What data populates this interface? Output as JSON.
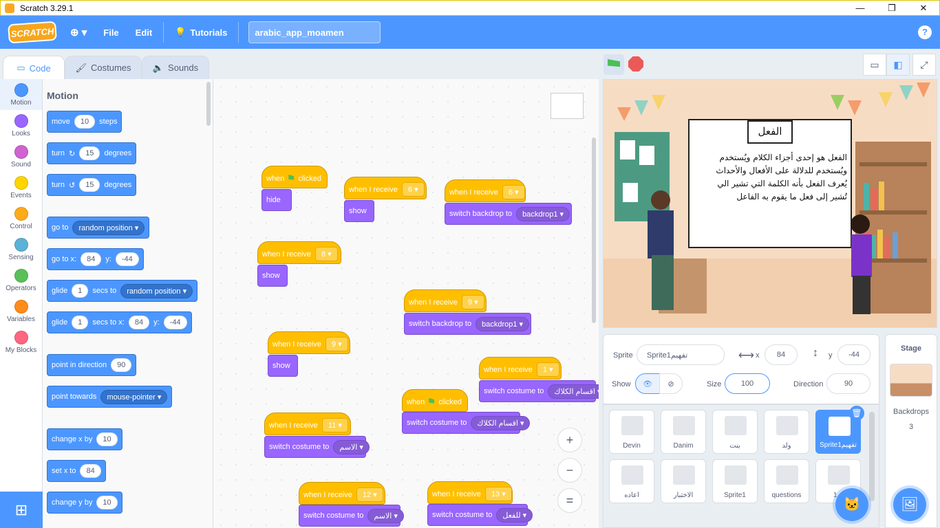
{
  "window": {
    "title": "Scratch 3.29.1",
    "min": "—",
    "max": "❐",
    "close": "✕"
  },
  "menubar": {
    "logo": "SCRATCH",
    "globe": "⊕ ▾",
    "file": "File",
    "edit": "Edit",
    "tutorials": "Tutorials",
    "project_title": "arabic_app_moamen",
    "help": "?"
  },
  "tabs": {
    "code": "Code",
    "costumes": "Costumes",
    "sounds": "Sounds"
  },
  "categories": [
    {
      "label": "Motion",
      "color": "#4c97ff"
    },
    {
      "label": "Looks",
      "color": "#9966ff"
    },
    {
      "label": "Sound",
      "color": "#cf63cf"
    },
    {
      "label": "Events",
      "color": "#ffd500"
    },
    {
      "label": "Control",
      "color": "#ffab19"
    },
    {
      "label": "Sensing",
      "color": "#5cb1d6"
    },
    {
      "label": "Operators",
      "color": "#59c059"
    },
    {
      "label": "Variables",
      "color": "#ff8c1a"
    },
    {
      "label": "My Blocks",
      "color": "#ff6680"
    }
  ],
  "palette": {
    "heading": "Motion",
    "move": {
      "a": "move",
      "n": "10",
      "b": "steps"
    },
    "turn_right": {
      "a": "turn",
      "n": "15",
      "b": "degrees"
    },
    "turn_left": {
      "a": "turn",
      "n": "15",
      "b": "degrees"
    },
    "goto": {
      "a": "go to",
      "d": "random position"
    },
    "gotoxy": {
      "a": "go to x:",
      "x": "84",
      "b": "y:",
      "y": "-44"
    },
    "glide": {
      "a": "glide",
      "n": "1",
      "b": "secs to",
      "d": "random position"
    },
    "glidexy": {
      "a": "glide",
      "n": "1",
      "b": "secs to x:",
      "x": "84",
      "c": "y:",
      "y": "-44"
    },
    "point": {
      "a": "point in direction",
      "n": "90"
    },
    "towards": {
      "a": "point towards",
      "d": "mouse-pointer"
    },
    "changex": {
      "a": "change x by",
      "n": "10"
    },
    "setx": {
      "a": "set x to",
      "n": "84"
    },
    "changey": {
      "a": "change y by",
      "n": "10"
    }
  },
  "scripts": {
    "when_flag": "when",
    "clicked": "clicked",
    "when_receive": "when I receive",
    "hide": "hide",
    "show": "show",
    "switch_backdrop": "switch backdrop to",
    "switch_costume": "switch costume to",
    "backdrop1": "backdrop1",
    "r6": "6",
    "r8": "8",
    "r9": "9",
    "r1": "1",
    "r11": "11",
    "r12": "12",
    "r13": "13",
    "c_sections": "اقسام الكلاك",
    "c_noun": "الاسم",
    "c_verb": "للفعل"
  },
  "zoom": {
    "in": "+",
    "out": "−",
    "reset": "="
  },
  "stage_content": {
    "heading": "الفعل",
    "body": [
      "الفعل هو إحدى أجزاء الكلام ويُستخدم",
      "ويُستخدم للدلالة على الأفعال والأحداث",
      "يُعرف الفعل بأنه الكلمة التي تشير الي",
      "تُشير إلى فعل ما يقوم به الفاعل"
    ]
  },
  "sprite_info": {
    "sprite_label": "Sprite",
    "sprite_name": "Sprite1تفهيم",
    "x_label": "x",
    "x": "84",
    "y_label": "y",
    "y": "-44",
    "show_label": "Show",
    "size_label": "Size",
    "size": "100",
    "direction_label": "Direction",
    "direction": "90"
  },
  "sprites": [
    {
      "name": "Devin"
    },
    {
      "name": "Danim"
    },
    {
      "name": "بنت"
    },
    {
      "name": "ولد"
    },
    {
      "name": "Sprite1تفهيم",
      "selected": true
    },
    {
      "name": "اعاده"
    },
    {
      "name": "الاختبار"
    },
    {
      "name": "Sprite1"
    },
    {
      "name": "questions"
    },
    {
      "name": "1..."
    }
  ],
  "stage_panel": {
    "title": "Stage",
    "backdrops_label": "Backdrops",
    "backdrops_count": "3"
  }
}
